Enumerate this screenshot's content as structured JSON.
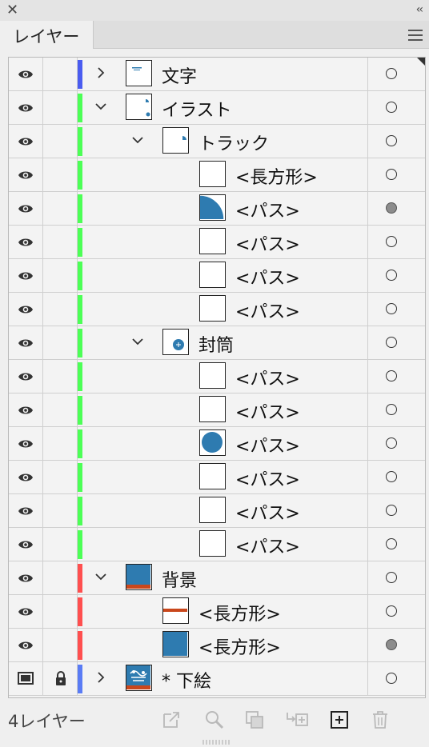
{
  "panel": {
    "close_symbol": "✕",
    "collapse_symbol": "‹‹",
    "tab_label": "レイヤー",
    "layer_count": "4レイヤー"
  },
  "colors": {
    "blue": "#4a5cf0",
    "green": "#4cff56",
    "red": "#ff4f4f",
    "blue2": "#5a7cf5",
    "accent_teal": "#2e7bb0",
    "accent_orange": "#c9471c"
  },
  "rows": [
    {
      "name": "文字",
      "indent": 0,
      "expand": "collapsed",
      "color": "blue",
      "thumb": "text",
      "target": "empty",
      "visibility": "eye"
    },
    {
      "name": "イラスト",
      "indent": 0,
      "expand": "expanded",
      "color": "green",
      "thumb": "illust",
      "target": "empty",
      "visibility": "eye"
    },
    {
      "name": "トラック",
      "indent": 1,
      "expand": "expanded",
      "color": "green",
      "thumb": "truck",
      "target": "empty",
      "visibility": "eye"
    },
    {
      "name": "<長方形>",
      "indent": 2,
      "expand": "none",
      "color": "green",
      "thumb": "blank",
      "target": "empty",
      "visibility": "eye"
    },
    {
      "name": "<パス>",
      "indent": 2,
      "expand": "none",
      "color": "green",
      "thumb": "quarter",
      "target": "selected",
      "visibility": "eye"
    },
    {
      "name": "<パス>",
      "indent": 2,
      "expand": "none",
      "color": "green",
      "thumb": "blank",
      "target": "empty",
      "visibility": "eye"
    },
    {
      "name": "<パス>",
      "indent": 2,
      "expand": "none",
      "color": "green",
      "thumb": "blank",
      "target": "empty",
      "visibility": "eye"
    },
    {
      "name": "<パス>",
      "indent": 2,
      "expand": "none",
      "color": "green",
      "thumb": "blank",
      "target": "empty",
      "visibility": "eye"
    },
    {
      "name": "封筒",
      "indent": 1,
      "expand": "expanded",
      "color": "green",
      "thumb": "envelope",
      "target": "empty",
      "visibility": "eye"
    },
    {
      "name": "<パス>",
      "indent": 2,
      "expand": "none",
      "color": "green",
      "thumb": "blank",
      "target": "empty",
      "visibility": "eye"
    },
    {
      "name": "<パス>",
      "indent": 2,
      "expand": "none",
      "color": "green",
      "thumb": "blank",
      "target": "empty",
      "visibility": "eye"
    },
    {
      "name": "<パス>",
      "indent": 2,
      "expand": "none",
      "color": "green",
      "thumb": "circle",
      "target": "empty",
      "visibility": "eye"
    },
    {
      "name": "<パス>",
      "indent": 2,
      "expand": "none",
      "color": "green",
      "thumb": "blank",
      "target": "empty",
      "visibility": "eye"
    },
    {
      "name": "<パス>",
      "indent": 2,
      "expand": "none",
      "color": "green",
      "thumb": "blank",
      "target": "empty",
      "visibility": "eye"
    },
    {
      "name": "<パス>",
      "indent": 2,
      "expand": "none",
      "color": "green",
      "thumb": "blank",
      "target": "empty",
      "visibility": "eye"
    },
    {
      "name": "背景",
      "indent": 0,
      "expand": "expanded",
      "color": "red",
      "thumb": "bg",
      "target": "empty",
      "visibility": "eye"
    },
    {
      "name": "<長方形>",
      "indent": 1,
      "expand": "none",
      "color": "red",
      "thumb": "stripe",
      "target": "empty",
      "visibility": "eye"
    },
    {
      "name": "<長方形>",
      "indent": 1,
      "expand": "none",
      "color": "red",
      "thumb": "teal",
      "target": "selected",
      "visibility": "eye"
    },
    {
      "name": "* 下絵",
      "indent": 0,
      "expand": "collapsed",
      "color": "blue2",
      "thumb": "sketch",
      "target": "empty",
      "visibility": "template",
      "locked": true
    }
  ],
  "footer_icons": [
    "export-icon",
    "search-icon",
    "clip-mask-icon",
    "move-to-layer-icon",
    "new-layer-icon",
    "trash-icon"
  ]
}
